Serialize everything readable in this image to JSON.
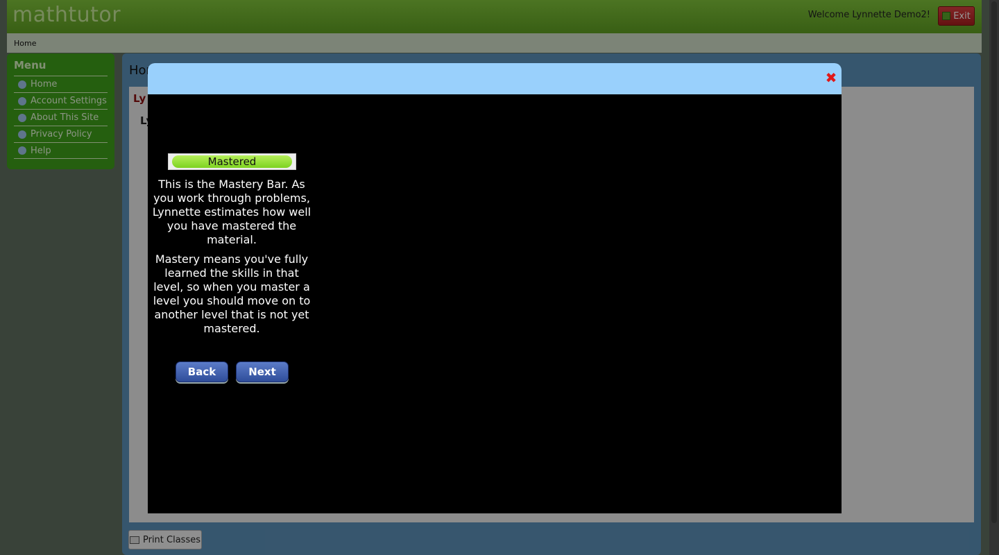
{
  "header": {
    "logo": "mathtutor",
    "welcome": "Welcome Lynnette Demo2!",
    "exit_label": "Exit"
  },
  "breadcrumb": "Home",
  "sidebar": {
    "title": "Menu",
    "items": [
      {
        "label": "Home",
        "icon": "home-icon"
      },
      {
        "label": "Account Settings",
        "icon": "id-card-icon"
      },
      {
        "label": "About This Site",
        "icon": "info-icon"
      },
      {
        "label": "Privacy Policy",
        "icon": "shield-icon"
      },
      {
        "label": "Help",
        "icon": "help-icon"
      }
    ]
  },
  "content": {
    "title": "Hor",
    "red_text": "Ly",
    "sub_text": "Ly",
    "print_label": "Print Classes"
  },
  "modal": {
    "close_symbol": "✖",
    "mastery_label": "Mastered",
    "paragraph1": "This is the Mastery Bar. As you work through problems, Lynnette estimates how well you have mastered the material.",
    "paragraph2": "Mastery means you've fully learned the skills in that level, so when you master a level you should move on to another level that is not yet mastered.",
    "back_label": "Back",
    "next_label": "Next"
  }
}
